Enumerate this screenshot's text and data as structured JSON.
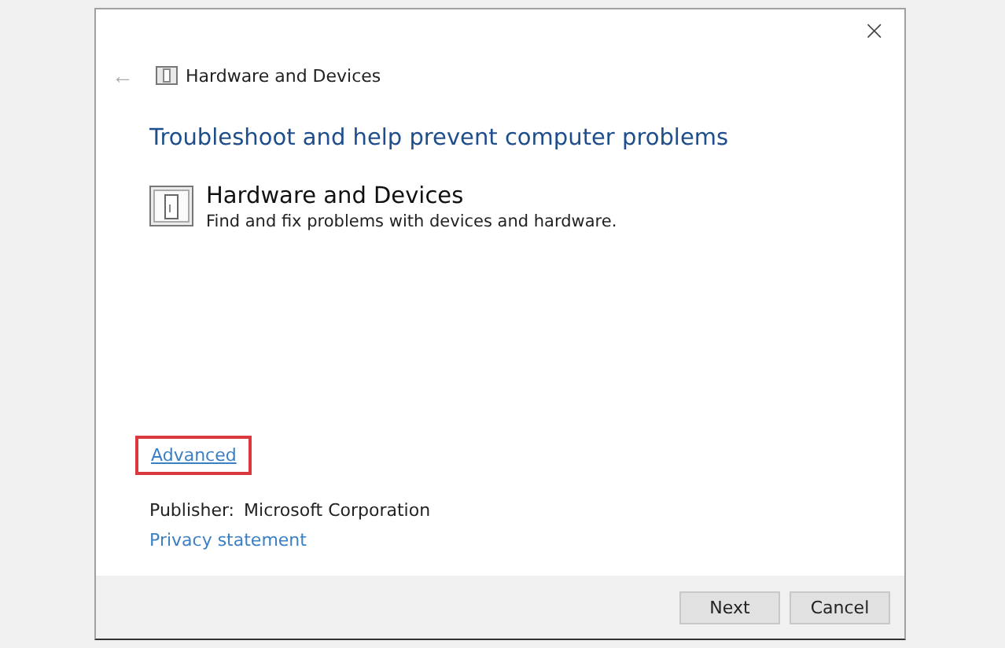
{
  "window": {
    "close": "×"
  },
  "nav": {
    "back": "←",
    "title": "Hardware and Devices"
  },
  "heading": "Troubleshoot and help prevent computer problems",
  "troubleshooter": {
    "title": "Hardware and Devices",
    "description": "Find and fix problems with devices and hardware."
  },
  "advanced_link": {
    "text": "Advanced",
    "highlighted": true
  },
  "publisher": {
    "label": "Publisher:",
    "value": "Microsoft Corporation"
  },
  "privacy_link": "Privacy statement",
  "buttons": [
    {
      "label": "Next"
    },
    {
      "label": "Cancel"
    }
  ]
}
